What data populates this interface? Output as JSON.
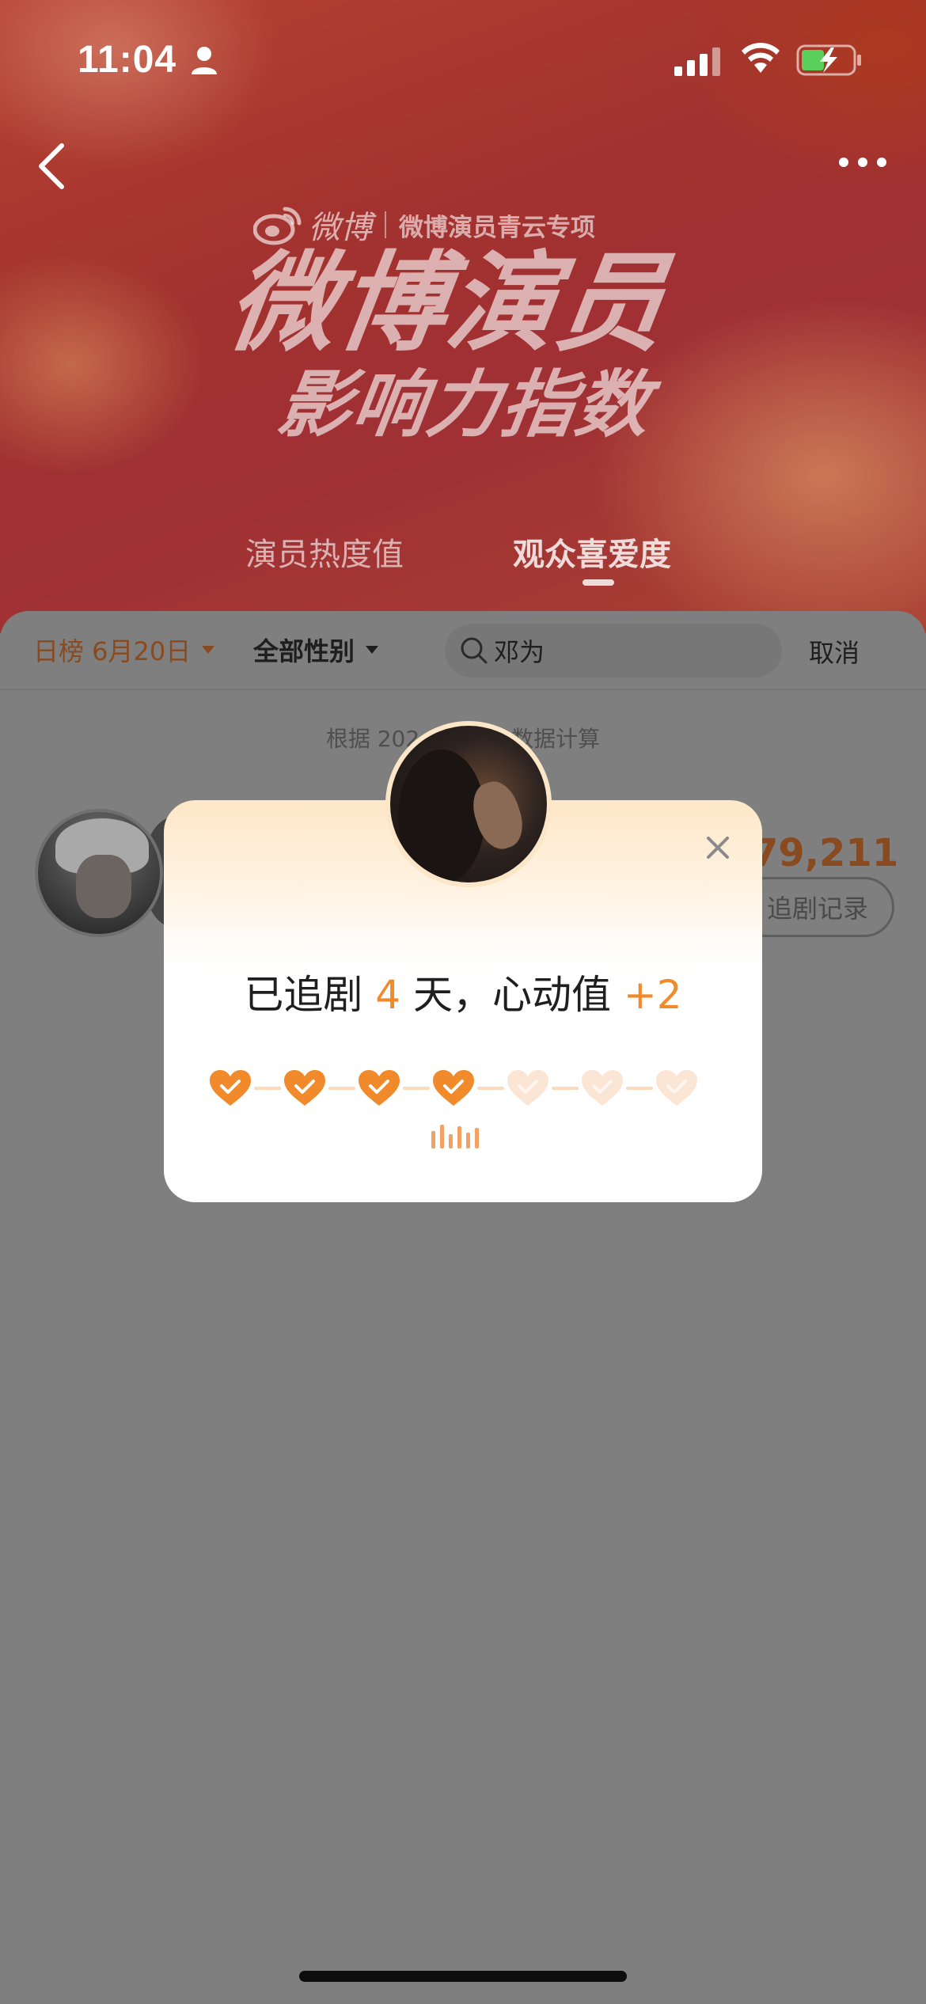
{
  "status_bar": {
    "time": "11:04"
  },
  "brand": {
    "name": "微博",
    "subtitle": "微博演员青云专项"
  },
  "hero": {
    "title": "微博演员",
    "subtitle": "影响力指数"
  },
  "tabs": [
    {
      "label": "演员热度值",
      "active": false
    },
    {
      "label": "观众喜爱度",
      "active": true
    }
  ],
  "filters": {
    "date": "日榜 6月20日",
    "gender": "全部性别",
    "search_value": "邓为",
    "cancel": "取消"
  },
  "data_note": {
    "prefix": "根据 202",
    "suffix": "数据计算"
  },
  "result": {
    "score": "79,211",
    "record_button": "追剧记录"
  },
  "modal": {
    "message_prefix": "已追剧 ",
    "days": "4",
    "message_middle": " 天，心动值 ",
    "bonus": "+2",
    "hearts": [
      true,
      true,
      true,
      true,
      false,
      false,
      false
    ]
  },
  "colors": {
    "accent": "#f08a2a",
    "accent_light": "#fbe6d6",
    "overlay": "#7f7f7f"
  }
}
